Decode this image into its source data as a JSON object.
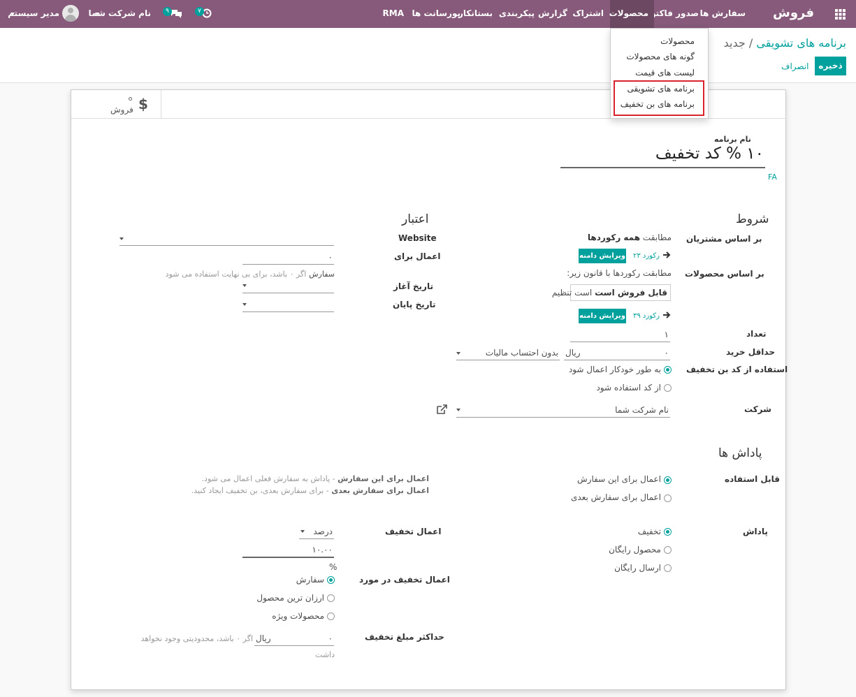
{
  "navbar": {
    "brand": "فروش",
    "menu": [
      "سفارش ها",
      "صدور فاکتور",
      "محصولات",
      "اشتراک",
      "گزارش",
      "پیکربندی",
      "بستانکار",
      "پورسانت ها",
      "RMA"
    ],
    "activity_count": "۷",
    "message_count": "۹",
    "company": "نام شرکت شما",
    "user": "مدیر سیستم"
  },
  "dropdown": {
    "items": [
      "محصولات",
      "گونه های محصولات",
      "لیست های قیمت",
      "برنامه های تشویقی",
      "برنامه های بن تخفیف"
    ]
  },
  "breadcrumb": {
    "parent": "برنامه های تشویقی",
    "separator": "/",
    "current": "جدید"
  },
  "buttons": {
    "save": "ذخیره",
    "discard": "انصراف"
  },
  "smart_button": {
    "label": "فروش"
  },
  "form": {
    "name_label": "نام برنامه",
    "name_value": "۱۰ % کد تخفیف",
    "lang": "FA",
    "conditions_title": "شروط",
    "customers_label": "بر اساس مشتریان",
    "customers_match_prefix": "مطابقت",
    "customers_match_bold": "همه رکوردها",
    "customers_records": "۲۳ رکورد",
    "edit_domain": "ویرایش دامنه",
    "products_label": "بر اساس محصولات",
    "products_match": "مطابقت رکوردها با قانون زیر:",
    "rule_bold": "قابل فروش است",
    "rule_suffix": "است تنظیم",
    "products_records": "۳۹ رکورد",
    "quantity_label": "تعداد",
    "quantity_value": "۱",
    "min_purchase_label": "حداقل خرید",
    "min_purchase_value": "۰",
    "currency": "ریال",
    "tax_option": "بدون احتساب مالیات",
    "coupon_use_label": "استفاده از کد بن تخفیف",
    "coupon_use_options": [
      "به طور خودکار اعمال شود",
      "از کد استفاده شود"
    ],
    "company_label": "شرکت",
    "company_value": "نام شرکت شما",
    "validity_title": "اعتبار",
    "website_label": "Website",
    "apply_for_label": "اعمال برای",
    "apply_for_value": "۰",
    "apply_for_unit": "سفارش",
    "apply_for_hint": "اگر ۰ باشد، برای بی نهایت استفاده می شود",
    "start_date_label": "تاریخ آغاز",
    "end_date_label": "تاریخ پایان",
    "rewards_title": "پاداش ها",
    "applicable_label": "قابل استفاده",
    "applicable_options": [
      "اعمال برای این سفارش",
      "اعمال برای سفارش بعدی"
    ],
    "applicable_help_1_bold": "اعمال برای این سفارش",
    "applicable_help_1": "- پاداش به سفارش فعلی اعمال می شود.",
    "applicable_help_2_bold": "اعمال برای سفارش بعدی",
    "applicable_help_2": "- برای سفارش بعدی، بن تخفیف ایجاد کنید.",
    "reward_label": "پاداش",
    "reward_options": [
      "تخفیف",
      "محصول رایگان",
      "ارسال رایگان"
    ],
    "discount_apply_label": "اعمال تخفیف",
    "discount_type": "درصد",
    "discount_value": "۱۰.۰۰",
    "percent_sign": "%",
    "discount_on_label": "اعمال تخفیف در مورد",
    "discount_on_options": [
      "سفارش",
      "ارزان ترین محصول",
      "محصولات ویژه"
    ],
    "max_discount_label": "حداکثر مبلغ تخفیف",
    "max_discount_value": "۰",
    "max_discount_hint_1": "اگر ۰ باشد، محدودیتی وجود نخواهد",
    "max_discount_hint_2": "داشت"
  },
  "colors": {
    "navbar": "#875a7b",
    "accent": "#00a09d",
    "highlight_box": "#d9232d"
  }
}
